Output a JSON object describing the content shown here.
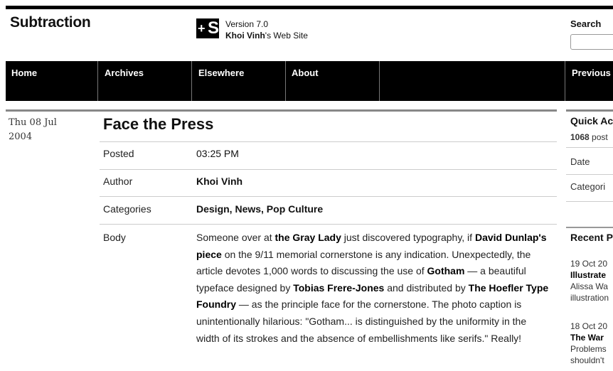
{
  "site": {
    "title": "Subtraction",
    "logo_text": "+S",
    "version": "Version 7.0",
    "owner_name": "Khoi Vinh",
    "owner_suffix": "'s Web Site"
  },
  "search": {
    "label": "Search",
    "value": ""
  },
  "nav": {
    "items": [
      {
        "label": "Home"
      },
      {
        "label": "Archives"
      },
      {
        "label": "Elsewhere"
      },
      {
        "label": "About"
      }
    ],
    "previous": "Previous"
  },
  "post": {
    "date_line1": "Thu 08 Jul",
    "date_line2": "2004",
    "title": "Face the Press",
    "posted_label": "Posted",
    "posted_value": "03:25 PM",
    "author_label": "Author",
    "author_value": "Khoi Vinh",
    "categories_label": "Categories",
    "categories_value": "Design, News, Pop Culture",
    "body_label": "Body",
    "body": [
      {
        "t": "Someone over at "
      },
      {
        "b": "the Gray Lady"
      },
      {
        "t": " just discovered typography, if "
      },
      {
        "b": "David Dunlap's piece"
      },
      {
        "t": " on the 9/11 memorial cornerstone is any indication. Unexpectedly, the article devotes 1,000 words to discussing the use of "
      },
      {
        "b": "Gotham"
      },
      {
        "t": " — a beautiful typeface designed by "
      },
      {
        "b": "Tobias Frere-Jones"
      },
      {
        "t": " and distributed by "
      },
      {
        "b": "The Hoefler Type Foundry"
      },
      {
        "t": " — as the principle face for the cornerstone. The photo caption is unintentionally hilarious: \"Gotham... is distinguished by the uniformity in the width of its strokes and the absence of embellishments like serifs.\" Really!"
      }
    ]
  },
  "sidebar": {
    "quick_title": "Quick Ac",
    "post_count": "1068",
    "post_count_suffix": " post",
    "date_label": "Date",
    "categories_label": "Categori",
    "recent_title": "Recent P",
    "recent": [
      {
        "date": "19 Oct 20",
        "title": "Illustrate",
        "l1": "Alissa Wa",
        "l2": "illustration"
      },
      {
        "date": "18 Oct 20",
        "title": "The War",
        "l1": "Problems ",
        "l2": "shouldn't "
      }
    ]
  }
}
